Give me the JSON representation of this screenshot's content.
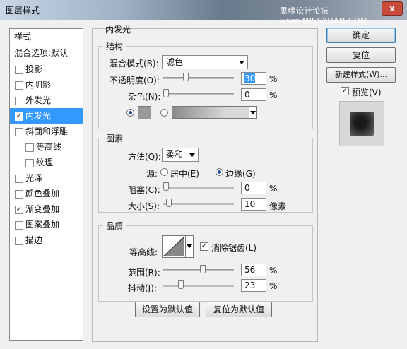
{
  "window": {
    "title": "图层样式",
    "watermark": "思缘设计论坛 www.MISSYUAN.COM",
    "close_label": "x"
  },
  "sidebar": {
    "header": "样式",
    "blend_options": "混合选项:默认",
    "items": [
      {
        "label": "投影",
        "checked": false,
        "sub": false,
        "selected": false
      },
      {
        "label": "内阴影",
        "checked": false,
        "sub": false,
        "selected": false
      },
      {
        "label": "外发光",
        "checked": false,
        "sub": false,
        "selected": false
      },
      {
        "label": "内发光",
        "checked": true,
        "sub": false,
        "selected": true
      },
      {
        "label": "斜面和浮雕",
        "checked": false,
        "sub": false,
        "selected": false
      },
      {
        "label": "等高线",
        "checked": false,
        "sub": true,
        "selected": false
      },
      {
        "label": "纹理",
        "checked": false,
        "sub": true,
        "selected": false
      },
      {
        "label": "光泽",
        "checked": false,
        "sub": false,
        "selected": false
      },
      {
        "label": "颜色叠加",
        "checked": false,
        "sub": false,
        "selected": false
      },
      {
        "label": "渐变叠加",
        "checked": true,
        "sub": false,
        "selected": false
      },
      {
        "label": "图案叠加",
        "checked": false,
        "sub": false,
        "selected": false
      },
      {
        "label": "描边",
        "checked": false,
        "sub": false,
        "selected": false
      }
    ]
  },
  "panel": {
    "title": "内发光",
    "structure": {
      "title": "结构",
      "blend_mode_label": "混合模式(B):",
      "blend_mode_value": "滤色",
      "opacity_label": "不透明度(O):",
      "opacity_value": "30",
      "opacity_unit": "%",
      "opacity_level": 0.3,
      "noise_label": "杂色(N):",
      "noise_value": "0",
      "noise_unit": "%",
      "noise_level": 0.0,
      "glow_color": "#999999"
    },
    "elements": {
      "title": "图素",
      "method_label": "方法(Q):",
      "method_value": "柔和",
      "source_label": "源:",
      "source_center": "居中(E)",
      "source_edge": "边缘(G)",
      "choke_label": "阻塞(C):",
      "choke_value": "0",
      "choke_unit": "%",
      "choke_level": 0.0,
      "size_label": "大小(S):",
      "size_value": "10",
      "size_unit": "像素",
      "size_level": 0.04
    },
    "quality": {
      "title": "品质",
      "contour_label": "等高线:",
      "antialias_label": "消除锯齿(L)",
      "antialias_checked": true,
      "range_label": "范围(R):",
      "range_value": "56",
      "range_unit": "%",
      "range_level": 0.56,
      "jitter_label": "抖动(J):",
      "jitter_value": "23",
      "jitter_unit": "%",
      "jitter_level": 0.23
    },
    "set_default": "设置为默认值",
    "reset_default": "复位为默认值"
  },
  "actions": {
    "ok": "确定",
    "reset": "复位",
    "new_style": "新建样式(W)...",
    "preview_label": "预览(V)",
    "preview_checked": true
  }
}
